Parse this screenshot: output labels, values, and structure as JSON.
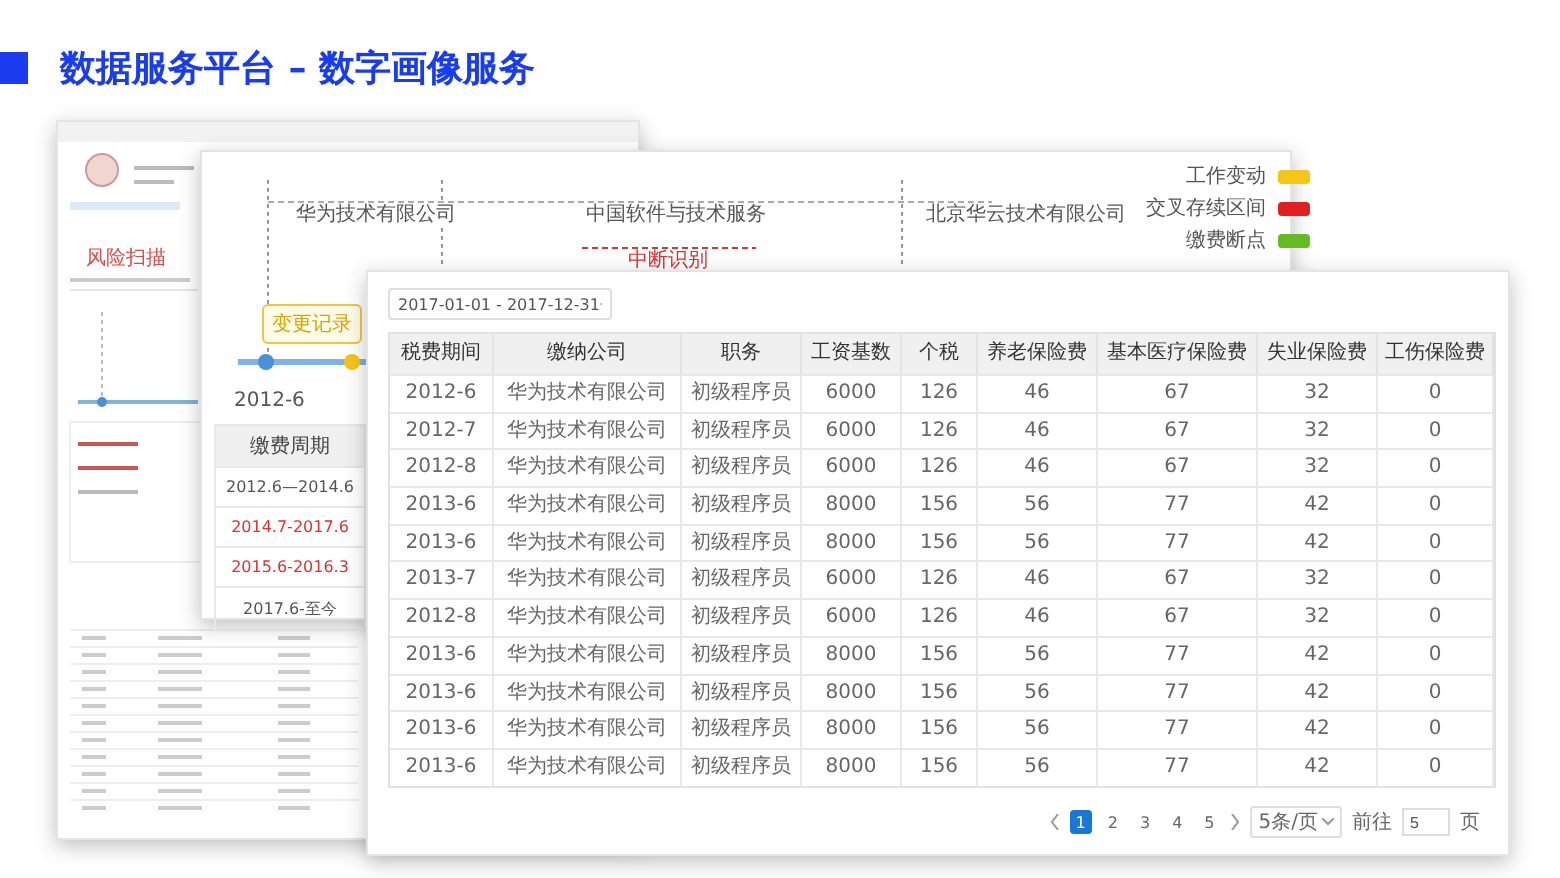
{
  "title": "数据服务平台 – 数字画像服务",
  "back_window": {
    "heading": "风险扫描"
  },
  "timeline_window": {
    "companies": [
      "华为技术有限公司",
      "中国软件与技术服务",
      "北京华云技术有限公司"
    ],
    "gap_label": "中断识别",
    "legend": [
      {
        "label": "工作变动",
        "color": "#f5c518"
      },
      {
        "label": "交叉存续区间",
        "color": "#e02020"
      },
      {
        "label": "缴费断点",
        "color": "#66bb22"
      }
    ],
    "start_date": "2012-6",
    "tooltip": "变更记录",
    "period_table": {
      "header": "缴费周期",
      "rows": [
        {
          "text": "2012.6—2014.6",
          "flagged": false
        },
        {
          "text": "2014.7-2017.6",
          "flagged": true
        },
        {
          "text": "2015.6-2016.3",
          "flagged": true
        },
        {
          "text": "2017.6-至今",
          "flagged": false
        }
      ]
    }
  },
  "table_window": {
    "date_range": "2017-01-01 - 2017-12-31",
    "columns": [
      "税费期间",
      "缴纳公司",
      "职务",
      "工资基数",
      "个税",
      "养老保险费",
      "基本医疗保险费",
      "失业保险费",
      "工伤保险费"
    ],
    "rows": [
      [
        "2012-6",
        "华为技术有限公司",
        "初级程序员",
        "6000",
        "126",
        "46",
        "67",
        "32",
        "0"
      ],
      [
        "2012-7",
        "华为技术有限公司",
        "初级程序员",
        "6000",
        "126",
        "46",
        "67",
        "32",
        "0"
      ],
      [
        "2012-8",
        "华为技术有限公司",
        "初级程序员",
        "6000",
        "126",
        "46",
        "67",
        "32",
        "0"
      ],
      [
        "2013-6",
        "华为技术有限公司",
        "初级程序员",
        "8000",
        "156",
        "56",
        "77",
        "42",
        "0"
      ],
      [
        "2013-6",
        "华为技术有限公司",
        "初级程序员",
        "8000",
        "156",
        "56",
        "77",
        "42",
        "0"
      ],
      [
        "2013-7",
        "华为技术有限公司",
        "初级程序员",
        "6000",
        "126",
        "46",
        "67",
        "32",
        "0"
      ],
      [
        "2012-8",
        "华为技术有限公司",
        "初级程序员",
        "6000",
        "126",
        "46",
        "67",
        "32",
        "0"
      ],
      [
        "2013-6",
        "华为技术有限公司",
        "初级程序员",
        "8000",
        "156",
        "56",
        "77",
        "42",
        "0"
      ],
      [
        "2013-6",
        "华为技术有限公司",
        "初级程序员",
        "8000",
        "156",
        "56",
        "77",
        "42",
        "0"
      ],
      [
        "2013-6",
        "华为技术有限公司",
        "初级程序员",
        "8000",
        "156",
        "56",
        "77",
        "42",
        "0"
      ],
      [
        "2013-6",
        "华为技术有限公司",
        "初级程序员",
        "8000",
        "156",
        "56",
        "77",
        "42",
        "0"
      ]
    ],
    "pagination": {
      "pages": [
        {
          "label": "1",
          "selected": true
        },
        {
          "label": "2",
          "selected": false
        },
        {
          "label": "3",
          "selected": false
        },
        {
          "label": "4",
          "selected": false
        },
        {
          "label": "5",
          "selected": false
        }
      ],
      "page_size": "5条/页",
      "goto_label": "前往",
      "goto_value": "5",
      "goto_suffix": "页"
    }
  }
}
